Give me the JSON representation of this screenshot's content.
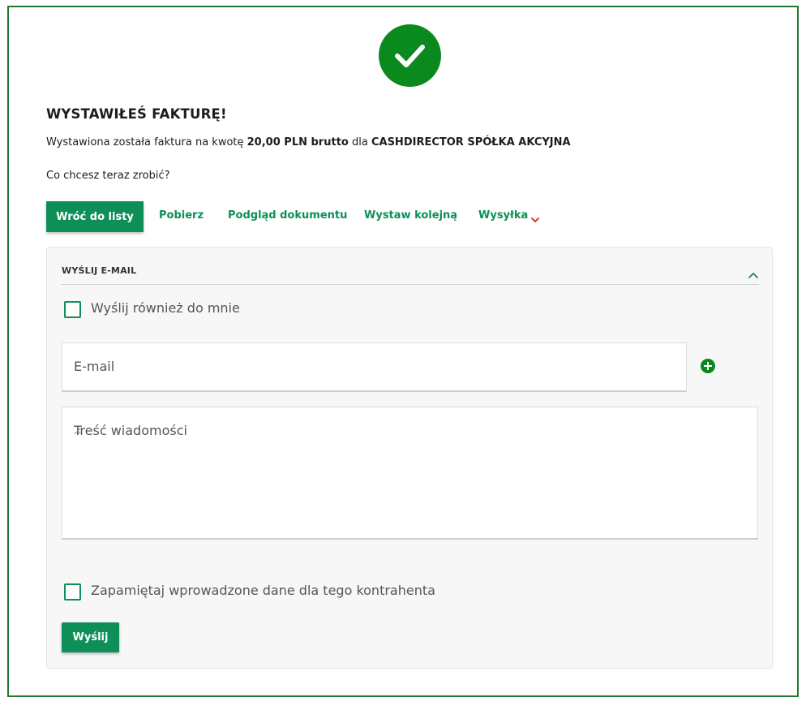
{
  "success": {
    "icon": "check-circle-icon",
    "title": "WYSTAWIŁEŚ FAKTURĘ!",
    "summary_prefix": "Wystawiona została faktura na kwotę",
    "amount": "20,00 PLN brutto",
    "summary_mid": "dla",
    "client": "CASHDIRECTOR SPÓŁKA AKCYJNA",
    "question": "Co chcesz teraz zrobić?"
  },
  "actions": {
    "back_label": "Wróć do listy",
    "download_label": "Pobierz",
    "preview_label": "Podgląd dokumentu",
    "next_label": "Wystaw kolejną",
    "shipping_label": "Wysyłka",
    "shipping_icon": "chevron-down-icon"
  },
  "email_panel": {
    "heading": "WYŚLIJ E-MAIL",
    "collapse_icon": "chevron-up-icon",
    "send_to_me_label": "Wyślij również do mnie",
    "email_placeholder": "E-mail",
    "add_icon": "plus-circle-icon",
    "message_placeholder": "Treść wiadomości",
    "remember_label": "Zapamiętaj wprowadzone dane dla tego kontrahenta",
    "send_label": "Wyślij"
  },
  "colors": {
    "accent": "#0d8f57",
    "success": "#0a8a1e",
    "frame_border": "#1f7a2f",
    "chevron_red": "#d0261e"
  }
}
